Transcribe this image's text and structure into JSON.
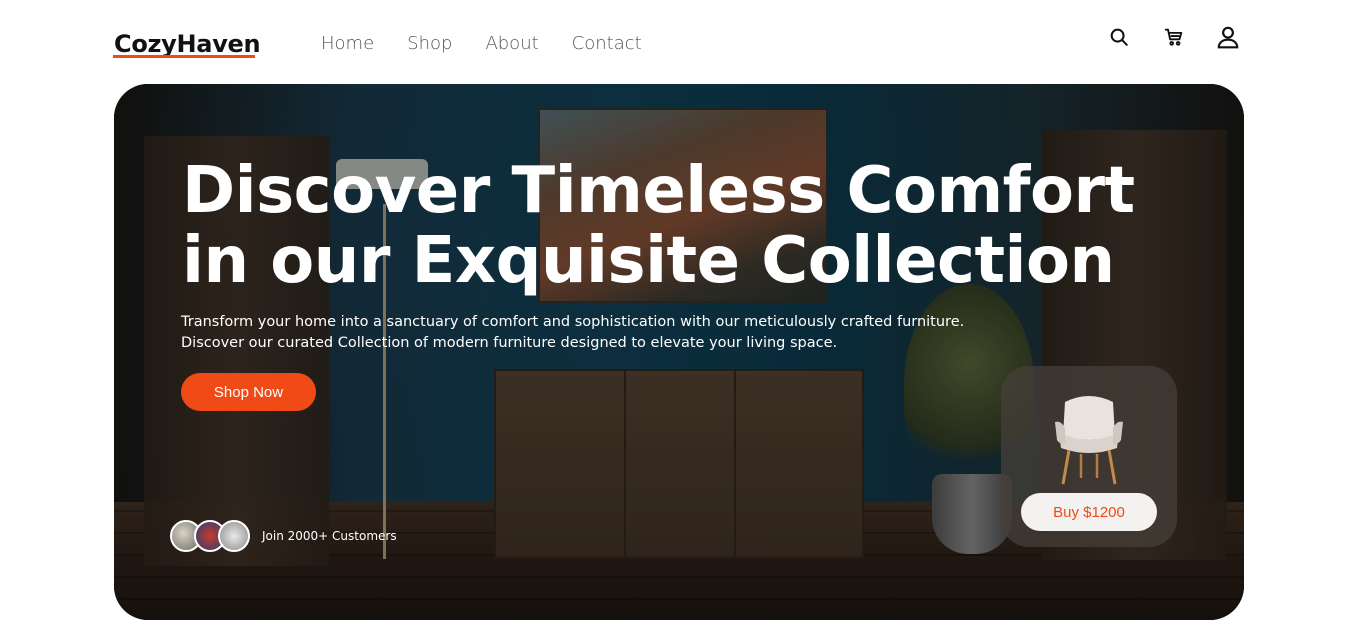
{
  "brand": {
    "name": "CozyHaven",
    "accent": "#f04a17"
  },
  "nav": {
    "items": [
      "Home",
      "Shop",
      "About",
      "Contact"
    ]
  },
  "header_icons": [
    "search-icon",
    "cart-icon",
    "user-icon"
  ],
  "hero": {
    "title_line1": "Discover Timeless Comfort",
    "title_line2": "in our Exquisite Collection",
    "subtitle_line1": "Transform your home into a sanctuary of comfort and sophistication with our meticulously crafted furniture.",
    "subtitle_line2": "Discover our curated Collection of modern furniture designed to elevate your living space.",
    "cta_label": "Shop Now",
    "customers_text": "Join 2000+ Customers"
  },
  "product_card": {
    "buy_label": "Buy $1200"
  }
}
